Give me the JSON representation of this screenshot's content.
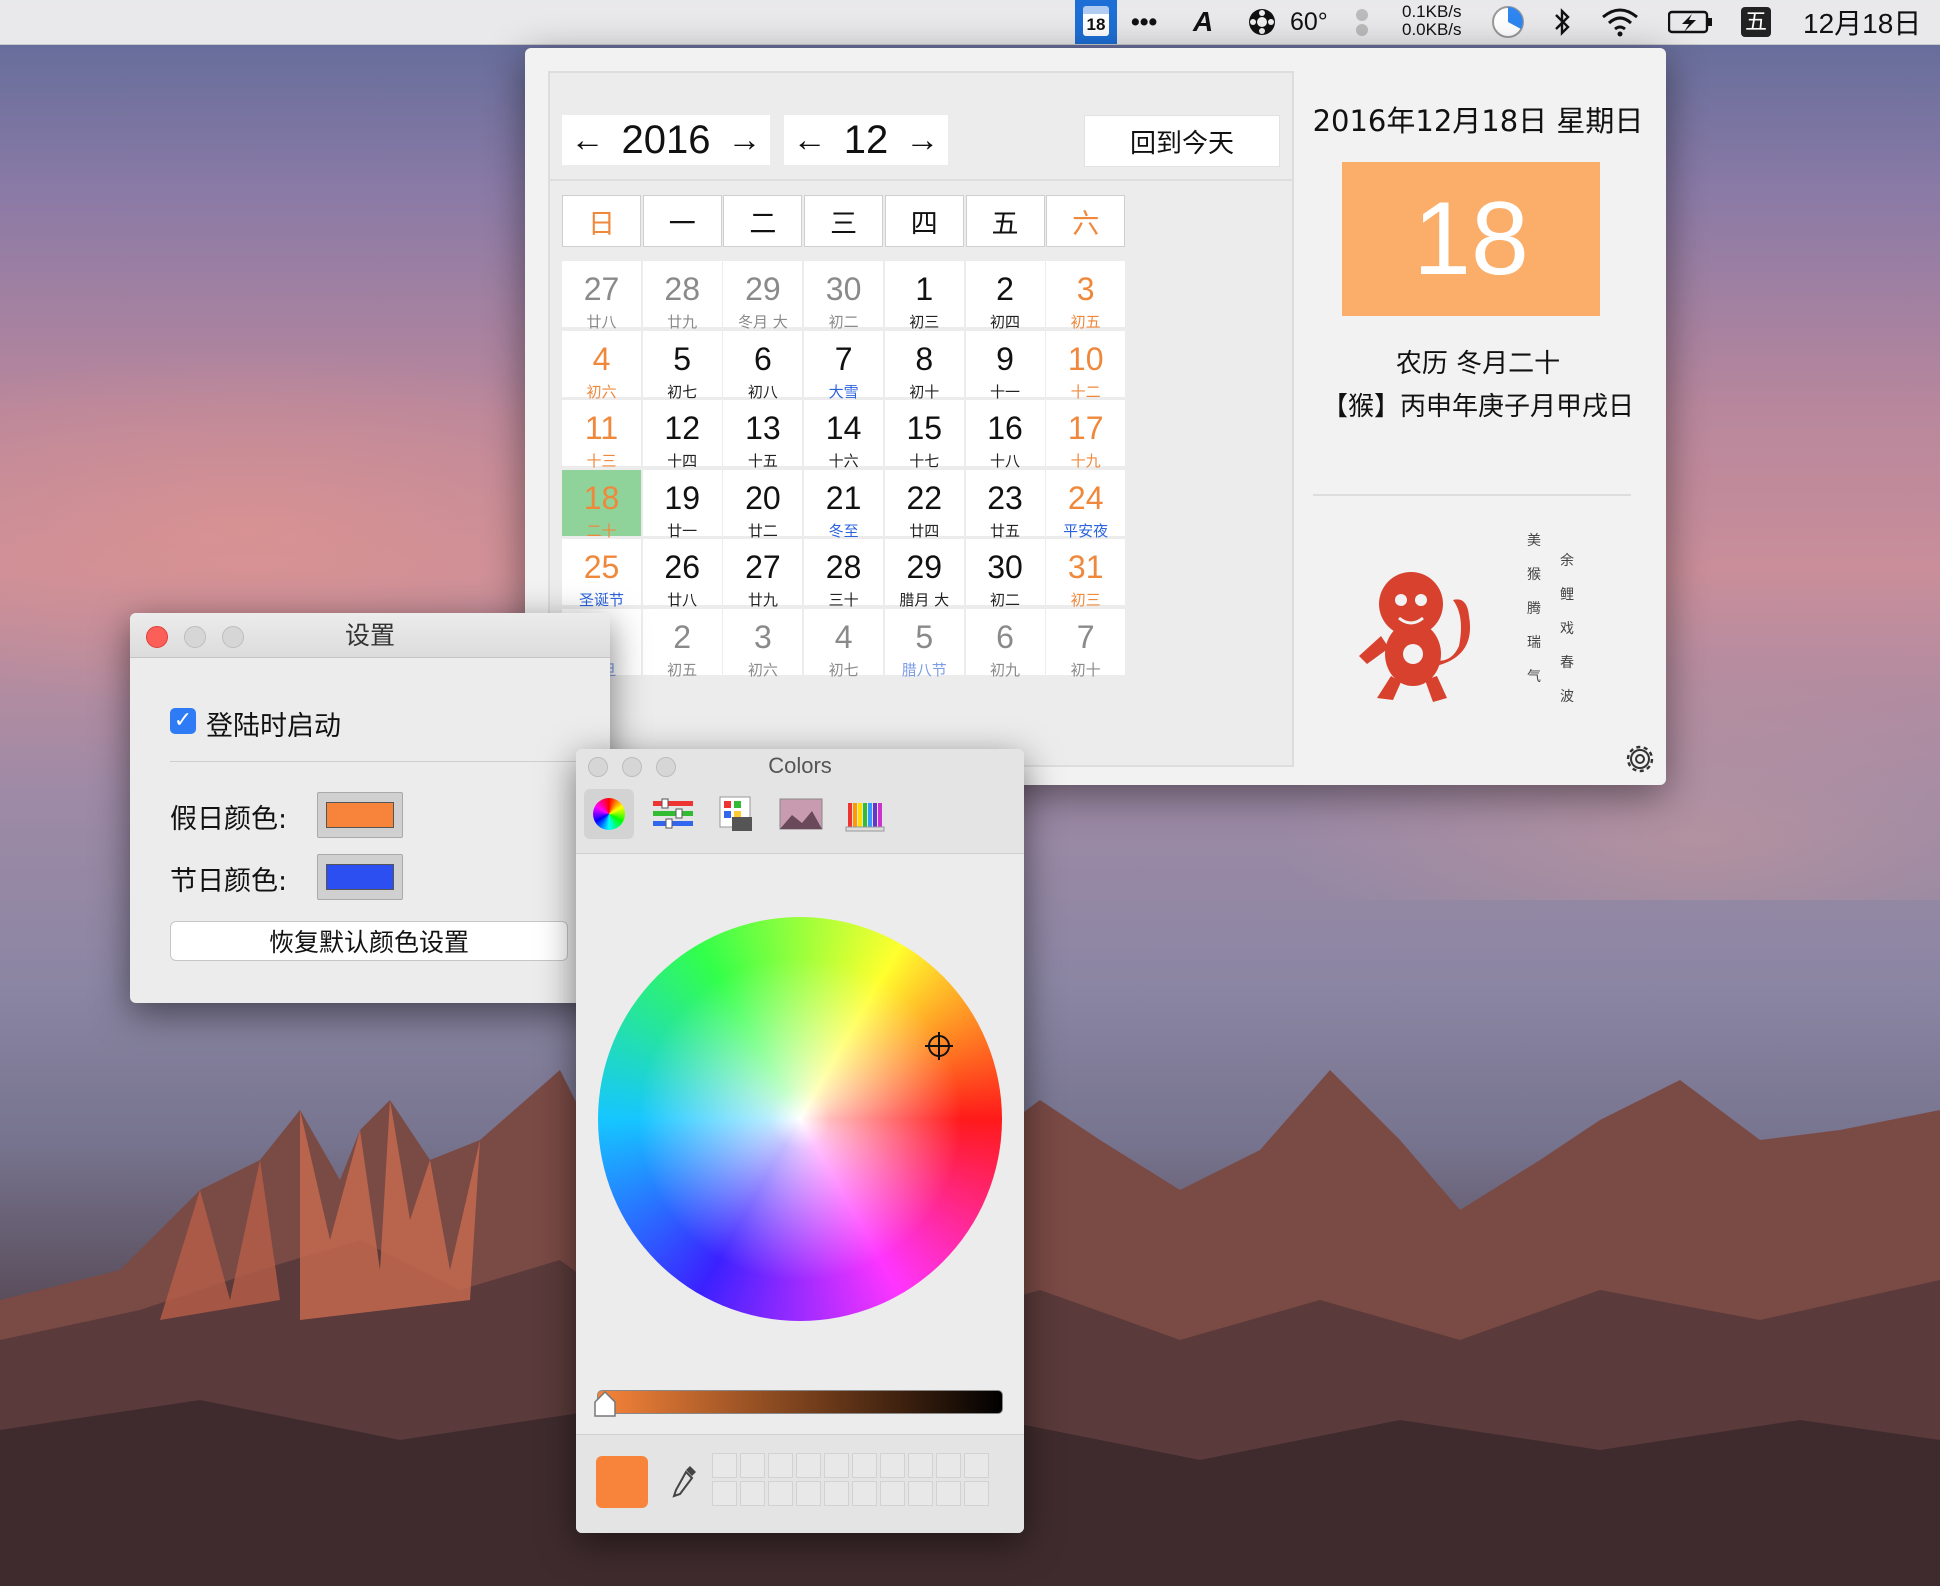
{
  "menubar": {
    "cal_icon_day": "18",
    "more": "•••",
    "ac_icon": "A",
    "temp": "60°",
    "net_up": "0.1KB/s",
    "net_down": "0.0KB/s",
    "ime": "五",
    "date": "12月18日",
    "icons": [
      "calendar-icon",
      "more-icon",
      "font-icon",
      "fan-icon",
      "dot-icon",
      "speed-icon",
      "pie-clock-icon",
      "bluetooth-icon",
      "wifi-icon",
      "battery-icon",
      "ime-icon"
    ]
  },
  "calendar": {
    "year": "2016",
    "month": "12",
    "prev_arrow": "←",
    "next_arrow": "→",
    "today_button": "回到今天",
    "weekdays": [
      "日",
      "一",
      "二",
      "三",
      "四",
      "五",
      "六"
    ],
    "weeks": [
      [
        {
          "d": "27",
          "l": "廿八",
          "t": "other"
        },
        {
          "d": "28",
          "l": "廿九",
          "t": "other"
        },
        {
          "d": "29",
          "l": "冬月 大",
          "t": "other"
        },
        {
          "d": "30",
          "l": "初二",
          "t": "other"
        },
        {
          "d": "1",
          "l": "初三",
          "t": "norm"
        },
        {
          "d": "2",
          "l": "初四",
          "t": "norm"
        },
        {
          "d": "3",
          "l": "初五",
          "t": "wkend"
        }
      ],
      [
        {
          "d": "4",
          "l": "初六",
          "t": "wkend"
        },
        {
          "d": "5",
          "l": "初七",
          "t": "norm"
        },
        {
          "d": "6",
          "l": "初八",
          "t": "norm"
        },
        {
          "d": "7",
          "l": "大雪",
          "t": "norm",
          "lt": "fest"
        },
        {
          "d": "8",
          "l": "初十",
          "t": "norm"
        },
        {
          "d": "9",
          "l": "十一",
          "t": "norm"
        },
        {
          "d": "10",
          "l": "十二",
          "t": "wkend"
        }
      ],
      [
        {
          "d": "11",
          "l": "十三",
          "t": "wkend"
        },
        {
          "d": "12",
          "l": "十四",
          "t": "norm"
        },
        {
          "d": "13",
          "l": "十五",
          "t": "norm"
        },
        {
          "d": "14",
          "l": "十六",
          "t": "norm"
        },
        {
          "d": "15",
          "l": "十七",
          "t": "norm"
        },
        {
          "d": "16",
          "l": "十八",
          "t": "norm"
        },
        {
          "d": "17",
          "l": "十九",
          "t": "wkend"
        }
      ],
      [
        {
          "d": "18",
          "l": "二十",
          "t": "today"
        },
        {
          "d": "19",
          "l": "廿一",
          "t": "norm"
        },
        {
          "d": "20",
          "l": "廿二",
          "t": "norm"
        },
        {
          "d": "21",
          "l": "冬至",
          "t": "norm",
          "lt": "fest"
        },
        {
          "d": "22",
          "l": "廿四",
          "t": "norm"
        },
        {
          "d": "23",
          "l": "廿五",
          "t": "norm"
        },
        {
          "d": "24",
          "l": "平安夜",
          "t": "wkend",
          "lt": "fest"
        }
      ],
      [
        {
          "d": "25",
          "l": "圣诞节",
          "t": "wkend",
          "lt": "fest"
        },
        {
          "d": "26",
          "l": "廿八",
          "t": "norm"
        },
        {
          "d": "27",
          "l": "廿九",
          "t": "norm"
        },
        {
          "d": "28",
          "l": "三十",
          "t": "norm"
        },
        {
          "d": "29",
          "l": "腊月 大",
          "t": "norm"
        },
        {
          "d": "30",
          "l": "初二",
          "t": "norm"
        },
        {
          "d": "31",
          "l": "初三",
          "t": "wkend"
        }
      ],
      [
        {
          "d": "1",
          "l": "元旦",
          "t": "other",
          "lt": "fest"
        },
        {
          "d": "2",
          "l": "初五",
          "t": "other"
        },
        {
          "d": "3",
          "l": "初六",
          "t": "other"
        },
        {
          "d": "4",
          "l": "初七",
          "t": "other"
        },
        {
          "d": "5",
          "l": "腊八节",
          "t": "other",
          "lt": "fest"
        },
        {
          "d": "6",
          "l": "初九",
          "t": "other"
        },
        {
          "d": "7",
          "l": "初十",
          "t": "other"
        }
      ]
    ],
    "detail": {
      "date_line": "2016年12月18日 星期日",
      "big_day": "18",
      "lunar": "农历 冬月二十",
      "ganzhi": "【猴】丙申年庚子月甲戌日",
      "poem_col1": [
        "美",
        "猴",
        "腾",
        "瑞",
        "气"
      ],
      "poem_col2": [
        "余",
        "鲤",
        "戏",
        "春",
        "波"
      ]
    },
    "colors": {
      "weekend": "#f0883c",
      "festival": "#2b63dd",
      "today_bg": "#8fd39a",
      "big_day_bg": "#fbae6a"
    }
  },
  "settings": {
    "title": "设置",
    "launch_label": "登陆时启动",
    "launch_checked": true,
    "holiday_label": "假日颜色:",
    "holiday_color": "#f7843a",
    "festival_label": "节日颜色:",
    "festival_color": "#2b4ff0",
    "reset_button": "恢复默认颜色设置"
  },
  "colors_panel": {
    "title": "Colors",
    "tabs": [
      "color-wheel-icon",
      "sliders-icon",
      "palettes-icon",
      "image-palettes-icon",
      "pencils-icon"
    ],
    "current_color": "#f7843a",
    "brightness": 1.0,
    "swatch_count": 20
  }
}
